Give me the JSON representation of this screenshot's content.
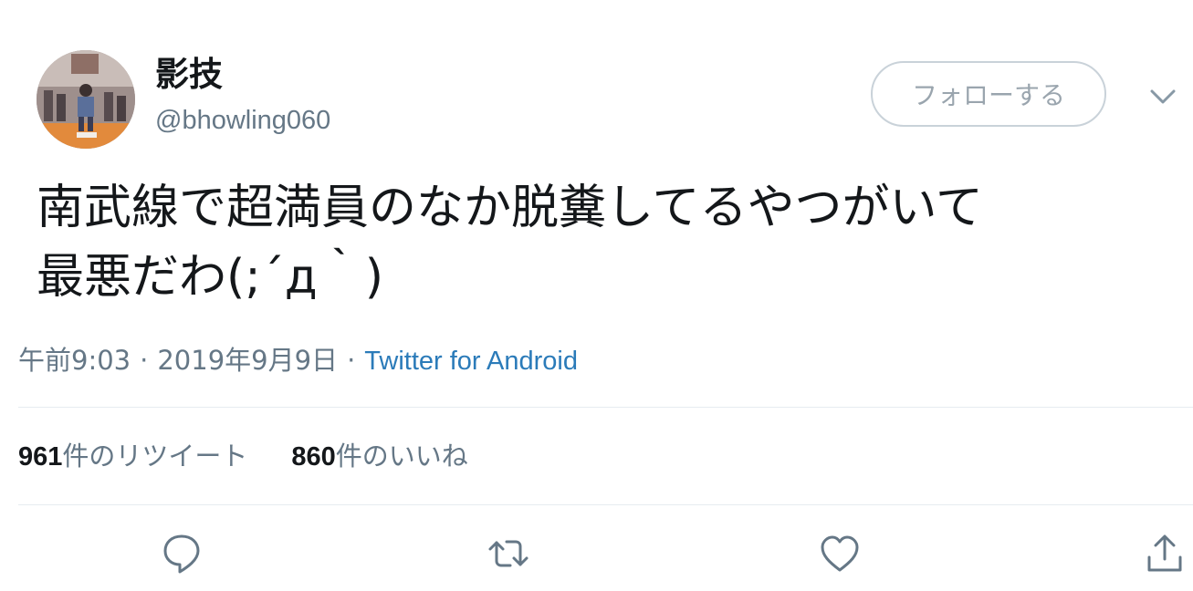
{
  "user": {
    "display_name": "影技",
    "handle": "@bhowling060"
  },
  "follow_button_label": "フォローする",
  "tweet": {
    "text": "南武線で超満員のなか脱糞してるやつがいて\n最悪だわ(;´д｀)"
  },
  "meta": {
    "time": "午前9:03",
    "separator": "·",
    "date": "2019年9月9日",
    "source": "Twitter for Android"
  },
  "stats": {
    "retweets_count": "961",
    "retweets_label": "件のリツイート",
    "likes_count": "860",
    "likes_label": "件のいいね"
  },
  "icons": {
    "reply": "reply-icon",
    "retweet": "retweet-icon",
    "like": "heart-icon",
    "share": "share-icon",
    "more": "chevron-down-icon"
  },
  "colors": {
    "link": "#2b7bb9",
    "secondary_text": "#657786",
    "primary_text": "#14171a",
    "divider": "#e6ecf0",
    "button_border": "#c9d2d9"
  }
}
